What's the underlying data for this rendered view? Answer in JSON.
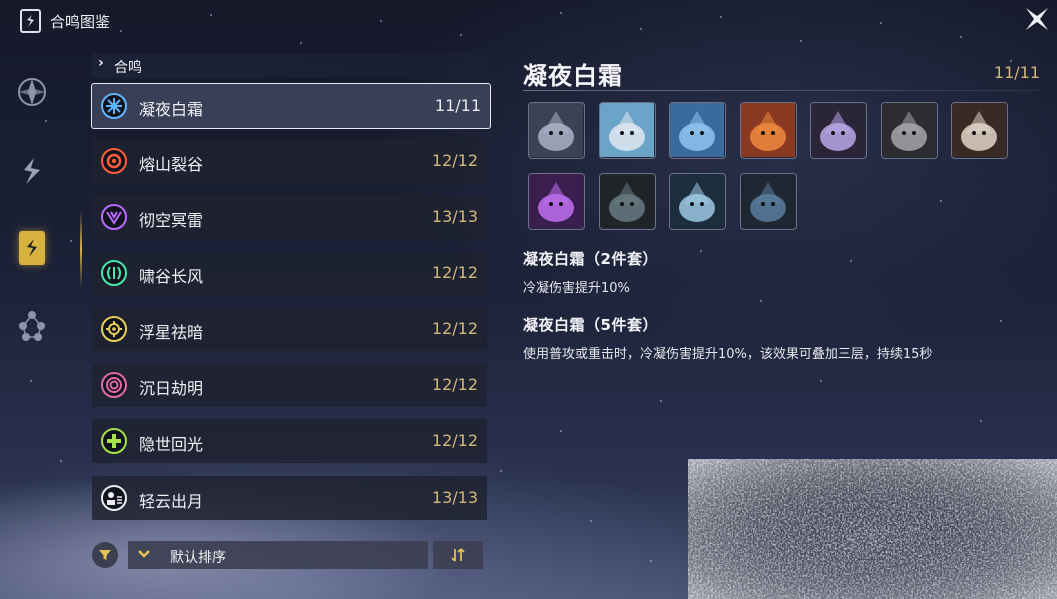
{
  "header": {
    "title": "合鸣图鉴"
  },
  "rail": {
    "items": [
      "echo-list",
      "weapon",
      "sonata-book",
      "resonance-chain"
    ]
  },
  "list": {
    "section_label": "合鸣",
    "items": [
      {
        "name": "凝夜白霜",
        "count": "11/11",
        "color": "#5fb6ff",
        "icon": "snowflake-icon"
      },
      {
        "name": "熔山裂谷",
        "count": "12/12",
        "color": "#ff5d3b",
        "icon": "flame-icon"
      },
      {
        "name": "彻空冥雷",
        "count": "13/13",
        "color": "#b86cff",
        "icon": "lightning-icon"
      },
      {
        "name": "啸谷长风",
        "count": "12/12",
        "color": "#48e6a8",
        "icon": "wind-icon"
      },
      {
        "name": "浮星祛暗",
        "count": "12/12",
        "color": "#e8cf5a",
        "icon": "star-icon"
      },
      {
        "name": "沉日劫明",
        "count": "12/12",
        "color": "#e06aa8",
        "icon": "eclipse-icon"
      },
      {
        "name": "隐世回光",
        "count": "12/12",
        "color": "#a6e24a",
        "icon": "heal-cross-icon"
      },
      {
        "name": "轻云出月",
        "count": "13/13",
        "color": "#ececf2",
        "icon": "cloud-moon-icon"
      }
    ]
  },
  "sort": {
    "label": "默认排序"
  },
  "detail": {
    "title": "凝夜白霜",
    "count": "11/11",
    "echo_icons": [
      "hooded-knight-echo",
      "pufferfish-echo",
      "ice-crystal-beast-echo",
      "orange-crystal-beast-echo",
      "dark-knight-echo",
      "white-wolf-echo",
      "antlered-beast-echo",
      "purple-sprout-echo",
      "dark-hooded-echo",
      "ice-dragon-echo",
      "blue-mech-echo"
    ],
    "set2_title": "凝夜白霜（2件套）",
    "set2_desc": "冷凝伤害提升10%",
    "set5_title": "凝夜白霜（5件套）",
    "set5_desc": "使用普攻或重击时，冷凝伤害提升10%，该效果可叠加三层，持续15秒"
  }
}
